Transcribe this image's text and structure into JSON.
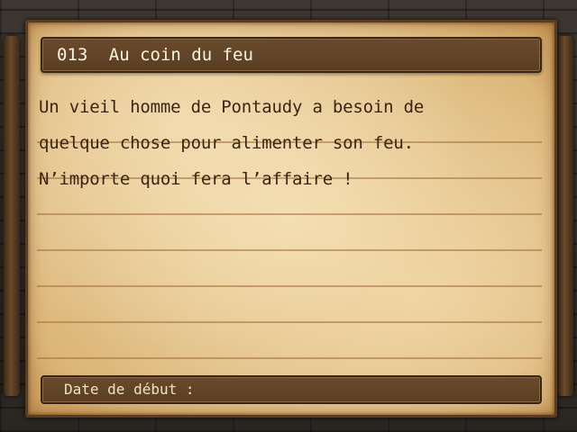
{
  "quest": {
    "number": "013",
    "title": "Au coin du feu",
    "description_lines": [
      "Un vieil homme de Pontaudy a besoin de",
      "quelque chose pour alimenter son feu.",
      "N’importe quoi fera l’affaire !"
    ],
    "start_date_label": "Date de début :",
    "start_date_value": ""
  },
  "colors": {
    "parchment": "#ecd3a2",
    "banner": "#5a3d22",
    "text": "#3a2511"
  }
}
